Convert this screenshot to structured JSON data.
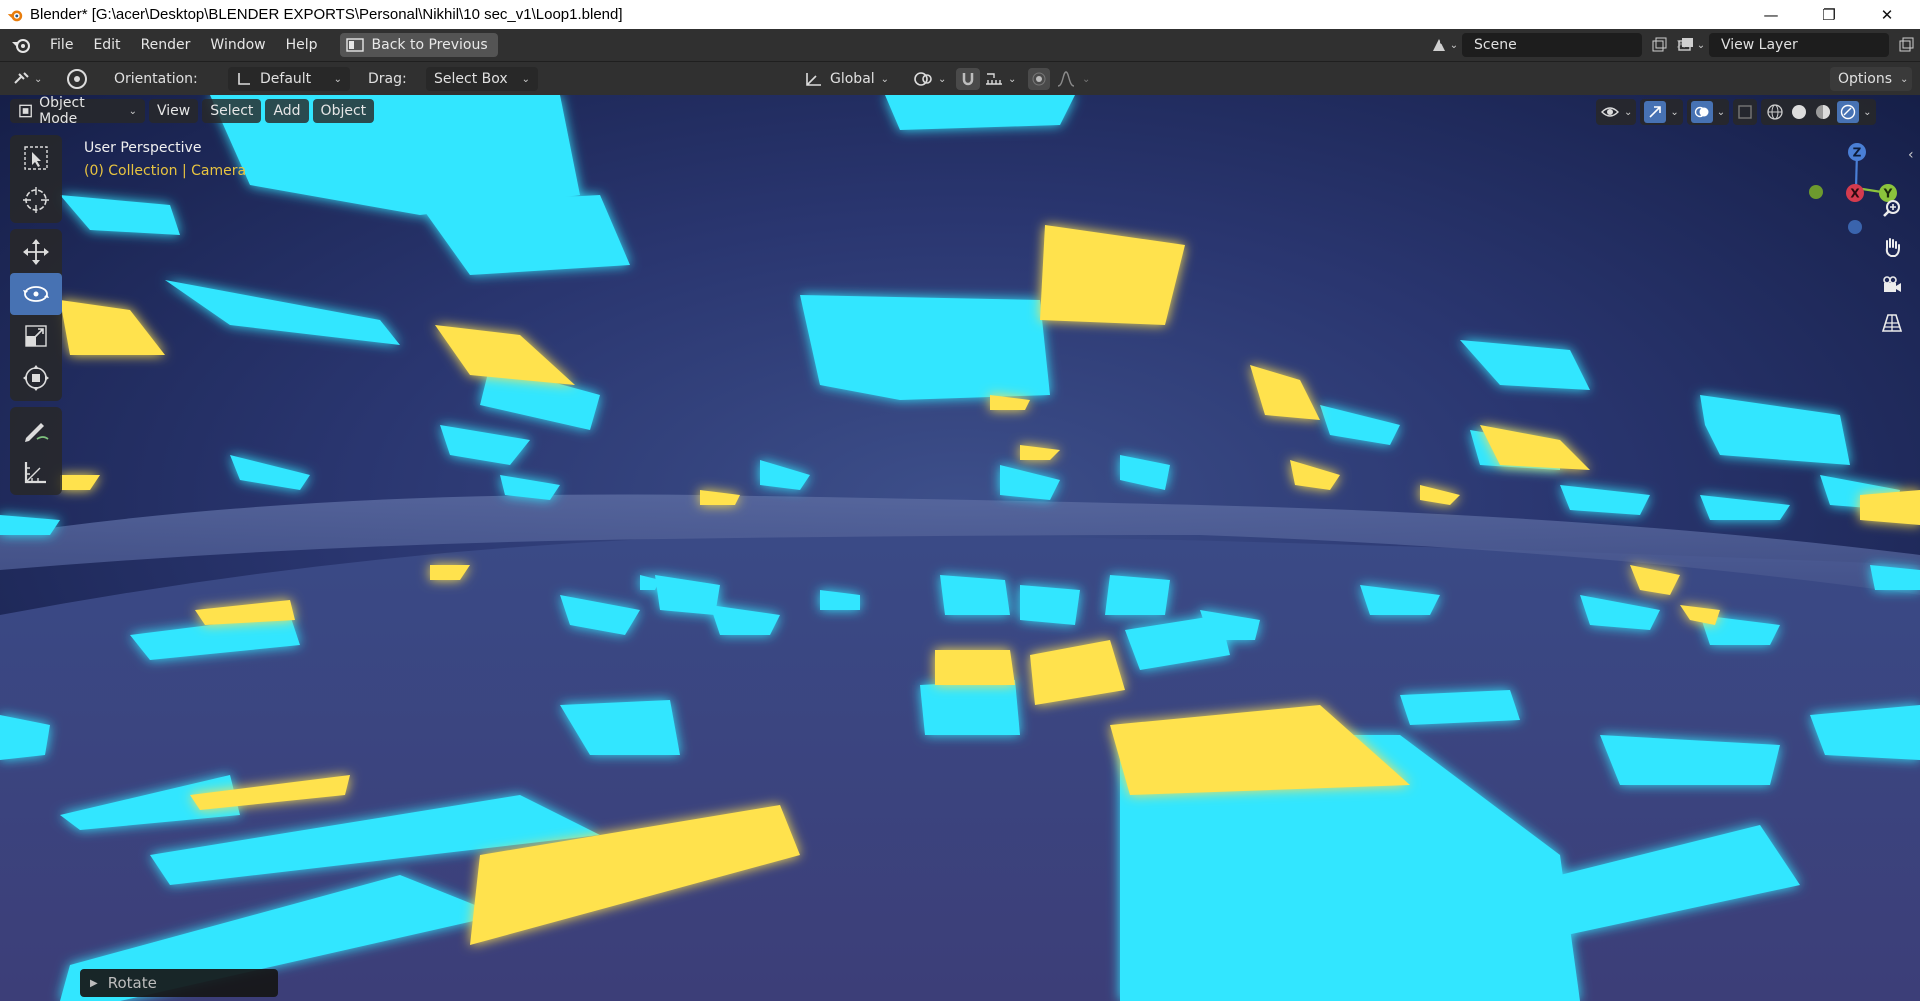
{
  "window": {
    "title": "Blender* [G:\\acer\\Desktop\\BLENDER EXPORTS\\Personal\\Nikhil\\10 sec_v1\\Loop1.blend]",
    "minimize": "—",
    "maximize": "❐",
    "close": "✕"
  },
  "menu": {
    "items": [
      "File",
      "Edit",
      "Render",
      "Window",
      "Help"
    ],
    "back_label": "Back to Previous"
  },
  "scene": {
    "name": "Scene",
    "view_layer": "View Layer"
  },
  "toolheader": {
    "orientation_label": "Orientation:",
    "orientation_value": "Default",
    "drag_label": "Drag:",
    "drag_value": "Select Box",
    "transform_orientation": "Global",
    "options_label": "Options"
  },
  "viewport": {
    "mode": "Object Mode",
    "menus": [
      "View",
      "Select",
      "Add",
      "Object"
    ],
    "perspective_label": "User Perspective",
    "collection_label": "(0) Collection | Camera",
    "gizmo": {
      "x": "X",
      "y": "Y",
      "z": "Z"
    },
    "last_operator": "Rotate"
  },
  "colors": {
    "cyan": "#33e6ff",
    "yellow": "#ffe24d",
    "dark_blue": "#1a2550",
    "ui_bg": "#303030",
    "active_tool": "#4772b3",
    "collection_text": "#e8c440"
  }
}
